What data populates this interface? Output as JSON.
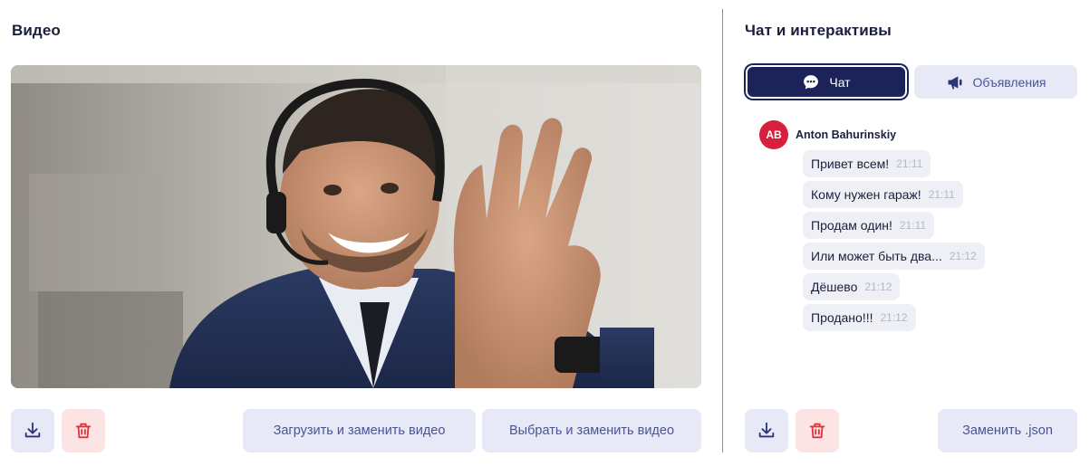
{
  "video_section": {
    "title": "Видео",
    "upload_replace_label": "Загрузить и заменить видео",
    "choose_replace_label": "Выбрать и заменить видео"
  },
  "chat_section": {
    "title": "Чат и интерактивы",
    "tabs": [
      {
        "label": "Чат",
        "icon": "chat-bubble-icon",
        "active": true
      },
      {
        "label": "Объявления",
        "icon": "megaphone-icon",
        "active": false
      }
    ],
    "author": {
      "initials": "AB",
      "name": "Anton Bahurinskiy"
    },
    "messages": [
      {
        "text": "Привет всем!",
        "time": "21:11"
      },
      {
        "text": "Кому нужен гараж!",
        "time": "21:11"
      },
      {
        "text": "Продам один!",
        "time": "21:11"
      },
      {
        "text": "Или может быть два...",
        "time": "21:12"
      },
      {
        "text": "Дёшево",
        "time": "21:12"
      },
      {
        "text": "Продано!!!",
        "time": "21:12"
      }
    ],
    "replace_json_label": "Заменить .json"
  },
  "colors": {
    "primary_dark": "#1c2358",
    "soft_button": "#e7e9f6",
    "danger_soft": "#fde4e4",
    "danger": "#e0333d",
    "avatar": "#d81f3c"
  }
}
